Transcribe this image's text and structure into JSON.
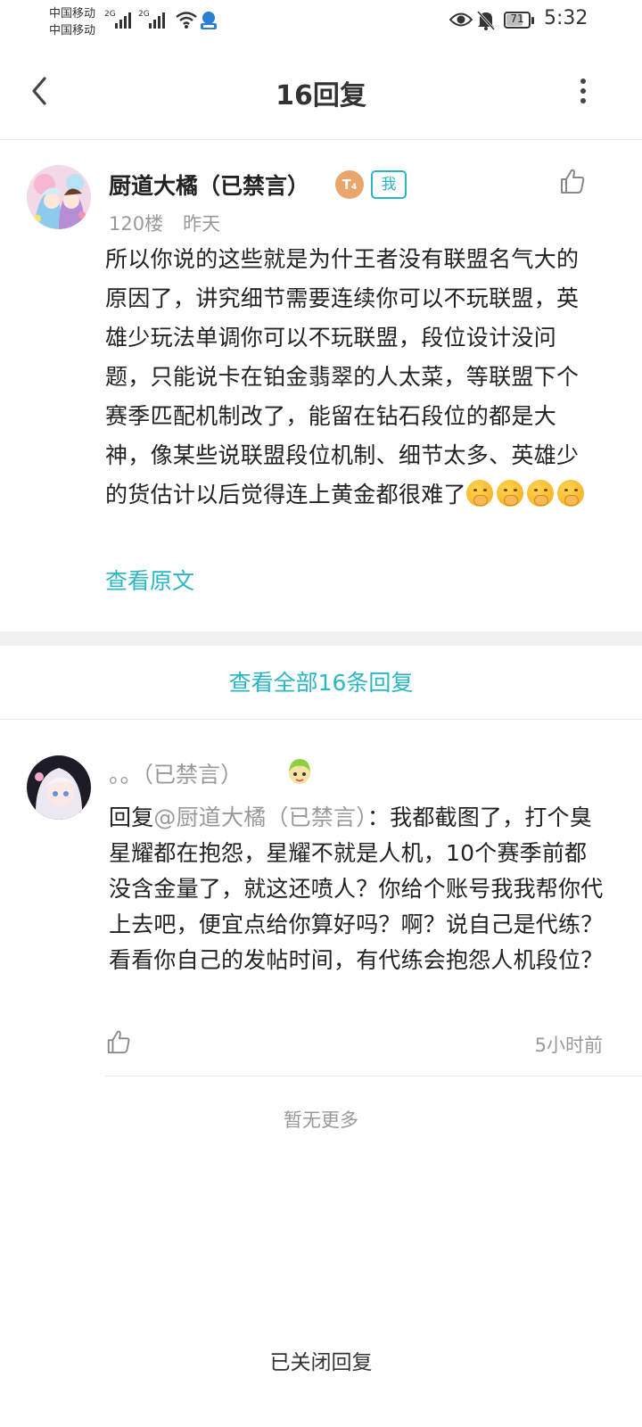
{
  "status_bar": {
    "carrier1": "中国移动",
    "carrier2": "中国移动",
    "net1": "2G",
    "net2": "2G",
    "battery": "71",
    "time": "5:32"
  },
  "header": {
    "title": "16回复",
    "back_icon": "chevron-left-icon",
    "more_icon": "more-vertical-icon"
  },
  "main_comment": {
    "author": "厨道大橘（已禁言）",
    "level_badge": "T₄",
    "me_badge": "我",
    "floor": "120楼",
    "time": "昨天",
    "text": "所以你说的这些就是为什王者没有联盟名气大的原因了，讲究细节需要连续你可以不玩联盟，英雄少玩法单调你可以不玩联盟，段位设计没问题，只能说卡在铂金翡翠的人太菜，等联盟下个赛季匹配机制改了，能留在钻石段位的都是大神，像某些说联盟段位机制、细节太多、英雄少的货估计以后觉得连上黄金都很难了",
    "emoji_name": "face-with-hand-over-mouth",
    "emoji_count": 4,
    "view_original": "查看原文"
  },
  "view_all": "查看全部16条回复",
  "reply": {
    "author": "。。（已禁言）",
    "prefix": "回复",
    "mention": "@厨道大橘（已禁言）",
    "text": "：我都截图了，打个臭星耀都在抱怨，星耀不就是人机，10个赛季前都没含金量了，就这还喷人？你给个账号我我帮你代上去吧，便宜点给你算好吗？啊？说自己是代练？看看你自己的发帖时间，有代练会抱怨人机段位？",
    "time": "5小时前"
  },
  "no_more": "暂无更多",
  "closed_notice": "已关闭回复",
  "colors": {
    "accent": "#29b6c5",
    "muted": "#999999",
    "divider": "#e8e8e8"
  }
}
